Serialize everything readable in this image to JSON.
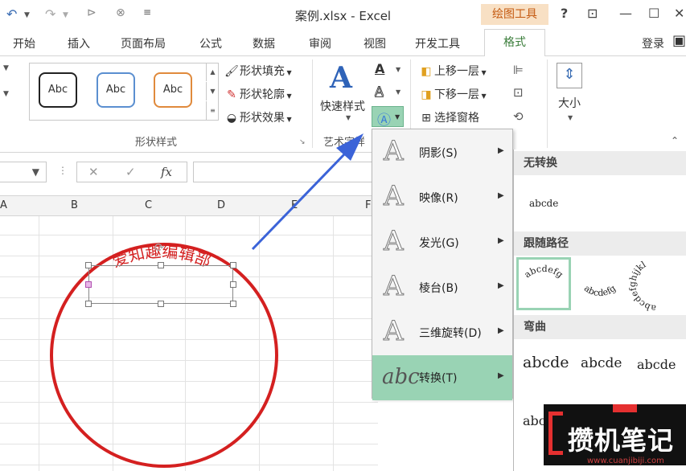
{
  "titlebar": {
    "title": "案例.xlsx - Excel",
    "context_tab": "绘图工具",
    "help": "?",
    "restore_ribbon": "⊡",
    "minimize": "—",
    "maximize": "☐",
    "close": "✕"
  },
  "tabs": [
    "开始",
    "插入",
    "页面布局",
    "公式",
    "数据",
    "审阅",
    "视图",
    "开发工具",
    "格式"
  ],
  "account": "登录",
  "ribbon": {
    "shape_samples": [
      "Abc",
      "Abc",
      "Abc"
    ],
    "shape_fill": "形状填充",
    "shape_outline": "形状轮廓",
    "shape_effects": "形状效果",
    "shape_styles_label": "形状样式",
    "quick_styles": "快速样式",
    "wordart_label": "艺术字样",
    "bring_forward": "上移一层",
    "send_backward": "下移一层",
    "selection_pane": "选择窗格",
    "size": "大小"
  },
  "formula_bar": {
    "fx": "fx",
    "cancel": "✕",
    "enter": "✓"
  },
  "columns": [
    "A",
    "B",
    "C",
    "D",
    "E",
    "F"
  ],
  "wordart_text": "爱知趣编辑部",
  "text_effects_menu": [
    {
      "label": "阴影(S)",
      "icon": "shadow-icon"
    },
    {
      "label": "映像(R)",
      "icon": "reflection-icon"
    },
    {
      "label": "发光(G)",
      "icon": "glow-icon"
    },
    {
      "label": "棱台(B)",
      "icon": "bevel-icon"
    },
    {
      "label": "三维旋转(D)",
      "icon": "3d-rotation-icon"
    },
    {
      "label": "转换(T)",
      "icon": "transform-icon"
    }
  ],
  "transform_submenu": {
    "no_transform": "无转换",
    "no_transform_sample": "abcde",
    "follow_path": "跟随路径",
    "follow_path_samples": [
      "abcdefg",
      "abcdefg",
      "abcdefghijkl"
    ],
    "warp": "弯曲",
    "warp_samples": [
      "abcde",
      "abcde",
      "abcde",
      "abcde"
    ]
  },
  "logo": {
    "text": "攒机笔记",
    "url": "www.cuanjibiji.com"
  },
  "colors": {
    "accent_green": "#3a7d3a",
    "context_tab_bg": "#f8e0c4",
    "menu_highlight": "#99d3b4",
    "circle_red": "#d42020",
    "arrow_blue": "#3b63d8"
  }
}
